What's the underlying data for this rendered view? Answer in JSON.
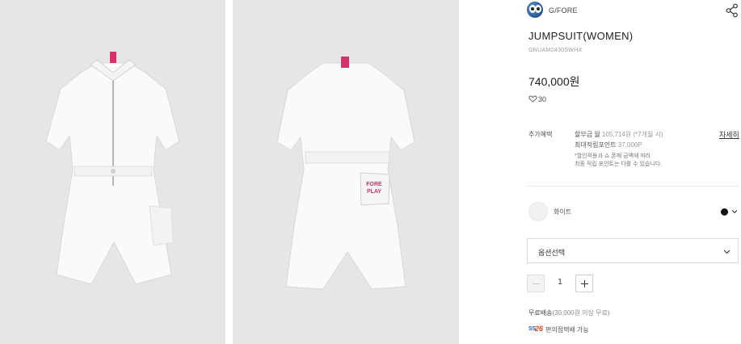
{
  "brand": {
    "name": "G/FORE",
    "logo_icon": "brand-logo-icon"
  },
  "share_icon": "share-icon",
  "product": {
    "title": "JUMPSUIT(WOMEN)",
    "code": "GNUAM2430SWHX",
    "price": "740,000원",
    "likes": "30",
    "likes_icon": "heart-icon"
  },
  "benefits": {
    "label": "추가혜택",
    "installment_prefix": "할부금 월 ",
    "installment_amount": "105,714원",
    "installment_suffix": " (*7개월 시)",
    "points_label": "최대적립포인트 ",
    "points_value": "37,000P",
    "note_line1": "*할인적용과 쇼 폰페 금액에 따라",
    "note_line2": "최종 적립 포인트는 다를 수 있습니다.",
    "detail_link": "자세히"
  },
  "color": {
    "name": "화이트",
    "swatch_color": "#f1f1f1",
    "selected_dot_color": "#111111"
  },
  "option_select": {
    "placeholder": "옵션선택"
  },
  "quantity": {
    "value": "1"
  },
  "shipping": {
    "label": "무료배송",
    "condition": "(30,000원 이상 무료)"
  },
  "delivery": {
    "badge_left": "SS",
    "badge_right": "26",
    "text": "편의점택배 가능"
  },
  "images": [
    {
      "name": "product-image-front",
      "pocket_text": ""
    },
    {
      "name": "product-image-back",
      "pocket_line1": "FORE",
      "pocket_line2": "PLAY"
    }
  ]
}
